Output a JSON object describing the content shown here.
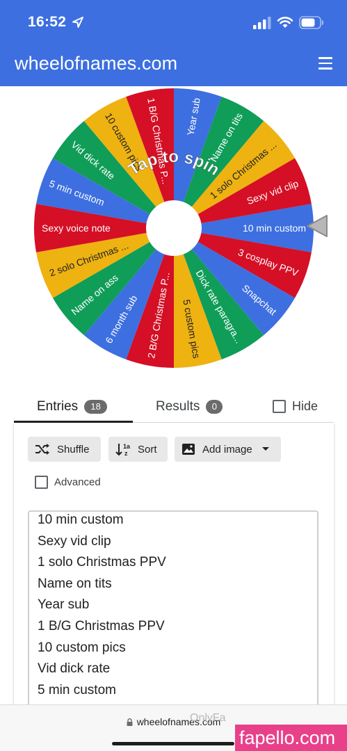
{
  "status_bar": {
    "time": "16:52",
    "icons": [
      "location-arrow-icon",
      "cellular-signal-icon",
      "wifi-icon",
      "battery-icon"
    ]
  },
  "header": {
    "title": "wheelofnames.com",
    "menu_icon": "hamburger-menu-icon",
    "background": "#3d6fe0"
  },
  "wheel": {
    "center_text": "Tap to spin",
    "segments": [
      {
        "label": "10 min custom",
        "color": "#3d6fe0"
      },
      {
        "label": "3 cosplay PPV",
        "color": "#d50f25"
      },
      {
        "label": "Snapchat",
        "color": "#3d6fe0"
      },
      {
        "label": "Dick rate paragra...",
        "color": "#0f9d58"
      },
      {
        "label": "5 custom pics",
        "color": "#eeb211"
      },
      {
        "label": "2 B/G Christmas P...",
        "color": "#d50f25"
      },
      {
        "label": "6 month sub",
        "color": "#3d6fe0"
      },
      {
        "label": "Name on ass",
        "color": "#0f9d58"
      },
      {
        "label": "2 solo Christmas ...",
        "color": "#eeb211"
      },
      {
        "label": "Sexy voice note",
        "color": "#d50f25"
      },
      {
        "label": "5 min custom",
        "color": "#3d6fe0"
      },
      {
        "label": "Vid dick rate",
        "color": "#0f9d58"
      },
      {
        "label": "10 custom pics",
        "color": "#eeb211"
      },
      {
        "label": "1 B/G Christmas P...",
        "color": "#d50f25"
      },
      {
        "label": "Year sub",
        "color": "#3d6fe0"
      },
      {
        "label": "Name on tits",
        "color": "#0f9d58"
      },
      {
        "label": "1 solo Christmas ...",
        "color": "#eeb211"
      },
      {
        "label": "Sexy vid clip",
        "color": "#d50f25"
      }
    ],
    "pointer_icon": "wheel-pointer-icon"
  },
  "tabs": [
    {
      "label": "Entries",
      "count": "18"
    },
    {
      "label": "Results",
      "count": "0"
    }
  ],
  "hide_label": "Hide",
  "toolbar": {
    "shuffle_label": "Shuffle",
    "sort_label": "Sort",
    "add_image_label": "Add image"
  },
  "advanced_label": "Advanced",
  "entries": [
    "10 min custom",
    "Sexy vid clip",
    "1 solo Christmas PPV",
    "Name on tits",
    "Year sub",
    "1 B/G Christmas PPV",
    "10 custom pics",
    "Vid dick rate",
    "5 min custom",
    "Sexy voice note"
  ],
  "browser": {
    "url": "wheelofnames.com"
  },
  "watermarks": {
    "onlyfans": "OnlyFa",
    "site": "fapello.com"
  }
}
